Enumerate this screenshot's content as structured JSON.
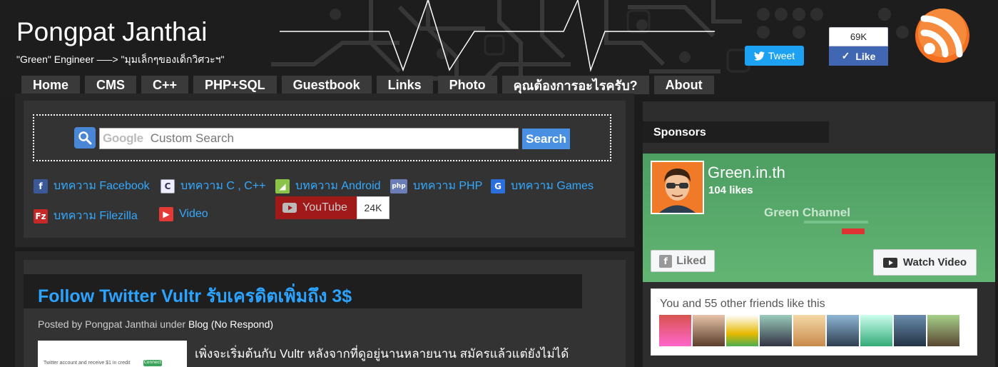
{
  "header": {
    "title": "Pongpat Janthai",
    "subtitle": "\"Green\" Engineer —–> \"มุมเล็กๆของเด็กวิศวะฯ\"",
    "tweet_label": "Tweet",
    "like_count": "69K",
    "like_label": "Like"
  },
  "nav": {
    "items": [
      "Home",
      "CMS",
      "C++",
      "PHP+SQL",
      "Guestbook",
      "Links",
      "Photo",
      "คุณต้องการอะไรครับ?",
      "About"
    ]
  },
  "search": {
    "placeholder_brand": "Google",
    "placeholder": "Custom Search",
    "button": "Search"
  },
  "categories": [
    {
      "label": "บทความ Facebook",
      "icon": "facebook-icon"
    },
    {
      "label": "บทความ C , C++",
      "icon": "c-file-icon"
    },
    {
      "label": "บทความ Android",
      "icon": "android-icon"
    },
    {
      "label": "บทความ PHP",
      "icon": "php-icon"
    },
    {
      "label": "บทความ Games",
      "icon": "games-icon"
    },
    {
      "label": "บทความ Filezilla",
      "icon": "filezilla-icon"
    },
    {
      "label": "Video",
      "icon": "video-icon"
    }
  ],
  "youtube": {
    "label": "YouTube",
    "count": "24K"
  },
  "post": {
    "title": "Follow Twitter Vultr รับเครดิตเพิ่มถึง 3$",
    "meta_prefix": "Posted by Pongpat Janthai under",
    "meta_category": "Blog",
    "meta_comments": "(No Respond)",
    "thumb_text": "Twitter account and receive $1 in credit",
    "thumb_badge": "Connect",
    "excerpt": "เพิ่งจะเริ่มต้นกับ Vultr หลังจากที่ดูอยู่นานหลายนาน สมัครแล้วแต่ยังไม่ได้"
  },
  "sidebar": {
    "sponsors_label": "Sponsors",
    "page_name": "Green.in.th",
    "page_likes": "104 likes",
    "channel_name": "Green Channel",
    "liked_label": "Liked",
    "watch_label": "Watch Video",
    "friends_text": "You and 55 other friends like this"
  },
  "colors": {
    "accent": "#2ba3ff",
    "twitter": "#1da1f2",
    "facebook": "#4267b2",
    "youtube": "#a01a1a",
    "fb_cover": "#55a86a"
  }
}
